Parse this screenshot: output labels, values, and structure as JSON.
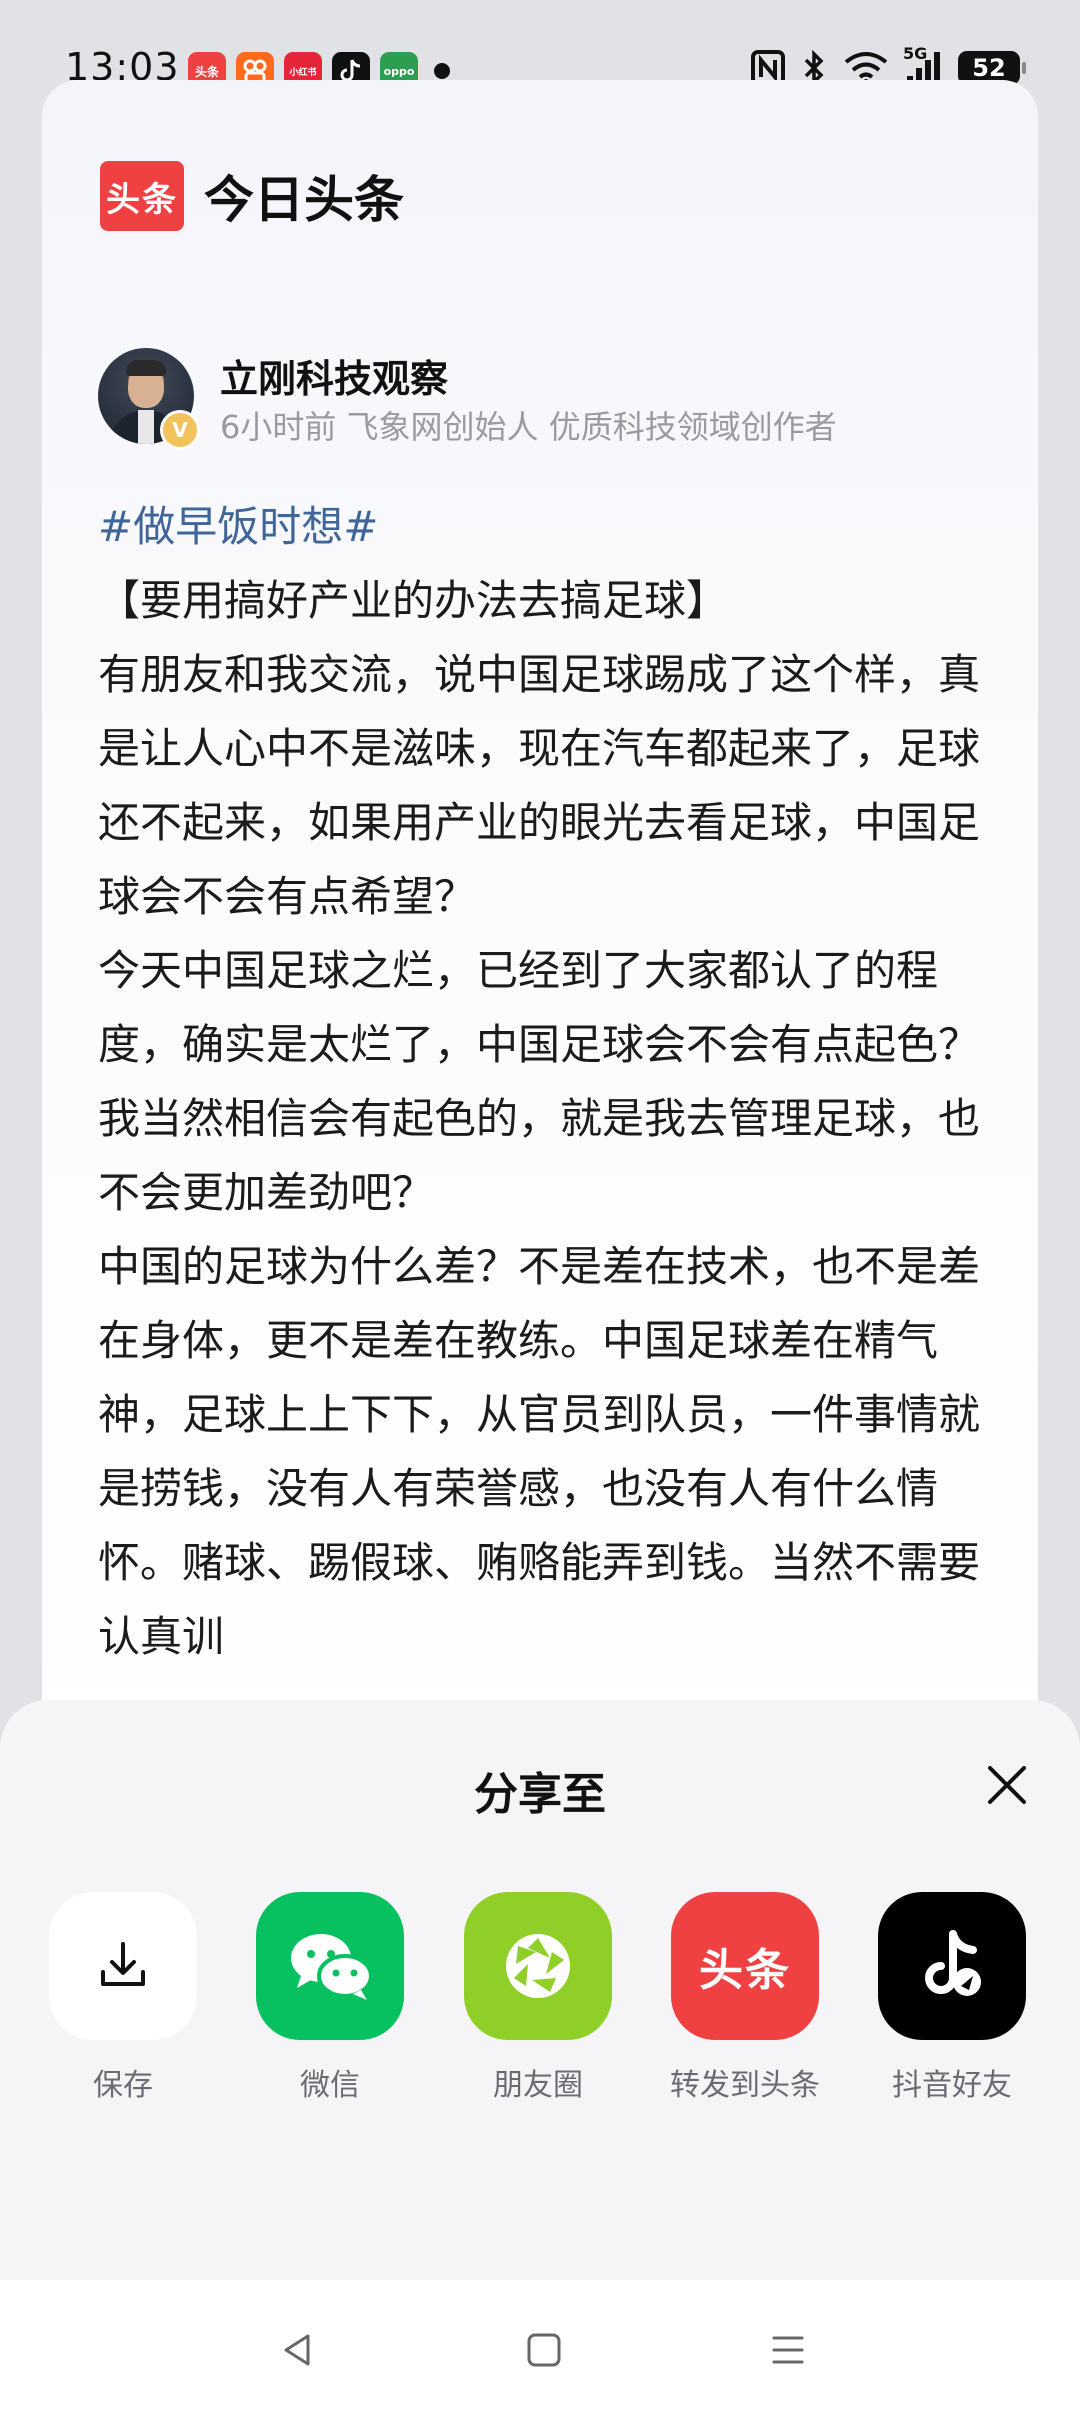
{
  "status_bar": {
    "time": "13:03",
    "notification_apps": [
      {
        "name": "toutiao-notif-icon",
        "label": "头条",
        "color": "#f04142"
      },
      {
        "name": "kuaishou-notif-icon",
        "label": "",
        "color": "#ff6a1f"
      },
      {
        "name": "xiaohongshu-notif-icon",
        "label": "小红书",
        "color": "#e6253b"
      },
      {
        "name": "douyin-notif-icon",
        "label": "",
        "color": "#111111"
      },
      {
        "name": "oppo-notif-icon",
        "label": "oppo",
        "color": "#2d9e4f"
      }
    ],
    "network": "5G",
    "battery": "52"
  },
  "brand": {
    "logo_text": "头条",
    "name": "今日头条",
    "color": "#f04142"
  },
  "author": {
    "name": "立刚科技观察",
    "meta": "6小时前 飞象网创始人 优质科技领域创作者",
    "badge": "V"
  },
  "article": {
    "hashtag": "#做早饭时想#",
    "title": "【要用搞好产业的办法去搞足球】",
    "paragraphs": [
      "有朋友和我交流，说中国足球踢成了这个样，真是让人心中不是滋味，现在汽车都起来了，足球还不起来，如果用产业的眼光去看足球，中国足球会不会有点希望？",
      "今天中国足球之烂，已经到了大家都认了的程度，确实是太烂了，中国足球会不会有点起色？我当然相信会有起色的，就是我去管理足球，也不会更加差劲吧？",
      "中国的足球为什么差？不是差在技术，也不是差在身体，更不是差在教练。中国足球差在精气神，足球上上下下，从官员到队员，一件事情就是捞钱，没有人有荣誉感，也没有人有什么情怀。赌球、踢假球、贿赂能弄到钱。当然不需要认真训"
    ],
    "hashtag_color": "#406599"
  },
  "share_sheet": {
    "title": "分享至",
    "items": [
      {
        "label": "保存",
        "icon": "download-icon",
        "bg": "#ffffff"
      },
      {
        "label": "微信",
        "icon": "wechat-icon",
        "bg": "#07c160"
      },
      {
        "label": "朋友圈",
        "icon": "moments-icon",
        "bg": "#8fcf28"
      },
      {
        "label": "转发到头条",
        "icon": "toutiao-icon",
        "bg": "#f04142",
        "icon_text": "头条"
      },
      {
        "label": "抖音好友",
        "icon": "douyin-icon",
        "bg": "#000000"
      }
    ]
  }
}
